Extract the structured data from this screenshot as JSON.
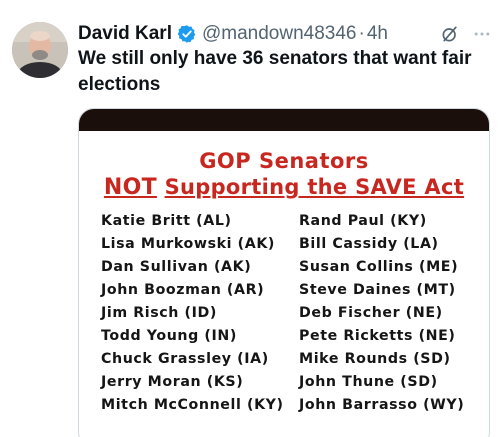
{
  "tweet": {
    "author_name": "David Karl",
    "handle": "@mandown48346",
    "separator": "·",
    "time": "4h",
    "text": "We still only have 36 senators that want fair elections"
  },
  "icons": {
    "avatar": "user-avatar-photo",
    "verified": "verified-badge-icon",
    "grok": "grok-icon",
    "more": "more-options-icon"
  },
  "colors": {
    "verified_blue": "#1d9bf0",
    "title_red": "#c8271f",
    "topbar": "#1b0f0c"
  },
  "graphic": {
    "title_line1": "GOP Senators",
    "title_line2_word1": "NOT",
    "title_line2_rest": "Supporting the SAVE Act",
    "left_column": [
      "Katie Britt (AL)",
      "Lisa Murkowski (AK)",
      "Dan Sullivan (AK)",
      "John Boozman (AR)",
      "Jim Risch (ID)",
      "Todd Young (IN)",
      "Chuck Grassley (IA)",
      "Jerry Moran (KS)",
      "Mitch McConnell (KY)"
    ],
    "right_column": [
      "Rand Paul (KY)",
      "Bill Cassidy (LA)",
      "Susan Collins (ME)",
      "Steve Daines (MT)",
      "Deb Fischer (NE)",
      "Pete Ricketts (NE)",
      "Mike Rounds (SD)",
      "John Thune (SD)",
      "John Barrasso (WY)"
    ]
  }
}
